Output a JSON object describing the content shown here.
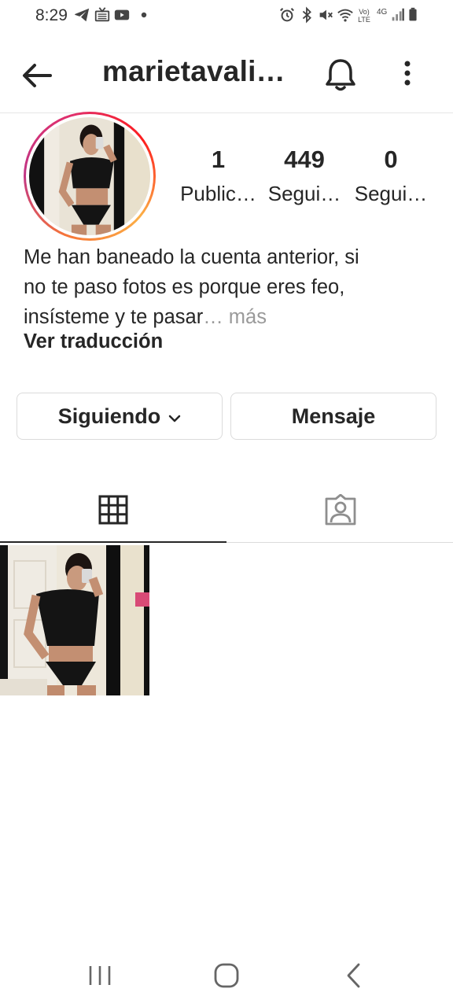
{
  "status_bar": {
    "time": "8:29",
    "left_icons": [
      "telegram-icon",
      "tv-icon",
      "youtube-icon",
      "notification-dot-icon"
    ],
    "right_icons": [
      "alarm-icon",
      "bluetooth-icon",
      "mute-icon",
      "wifi-icon",
      "volte-icon",
      "4g-icon",
      "signal-icon",
      "battery-icon"
    ],
    "volte_label": "Vo) LTE",
    "network_label": "4G"
  },
  "app_bar": {
    "username": "marietavali…",
    "icons": [
      "back-arrow-icon",
      "bell-icon",
      "more-vertical-icon"
    ]
  },
  "profile": {
    "stats": [
      {
        "value": "1",
        "label": "Public…"
      },
      {
        "value": "449",
        "label": "Segui…"
      },
      {
        "value": "0",
        "label": "Segui…"
      }
    ],
    "bio_lines": [
      "Me han baneado la cuenta anterior, si",
      "no te paso fotos es porque eres feo,",
      "insísteme y te pasar"
    ],
    "bio_more": "… más",
    "translate_label": "Ver traducción"
  },
  "actions": {
    "following_label": "Siguiendo",
    "message_label": "Mensaje"
  },
  "tabs": [
    {
      "icon": "grid-icon",
      "active": true
    },
    {
      "icon": "tagged-person-icon",
      "active": false
    }
  ],
  "colors": {
    "text": "#262626",
    "muted": "#9a9a9a",
    "border": "#dbdbdb",
    "story_ring": [
      "#f77737",
      "#e1306c",
      "#c13584",
      "#fcaf45"
    ]
  }
}
